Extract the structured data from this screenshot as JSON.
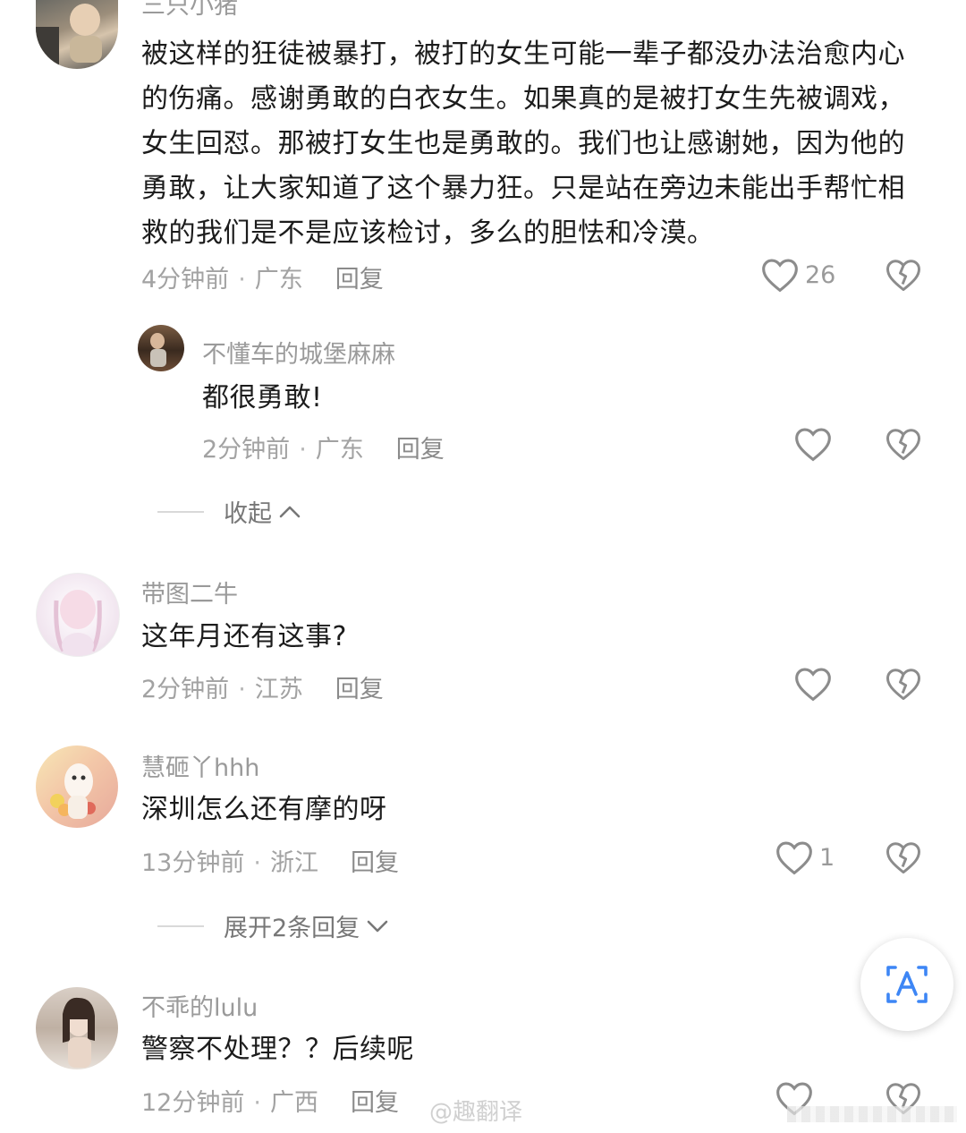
{
  "comments": [
    {
      "username": "三只小猪",
      "content": "被这样的狂徒被暴打，被打的女生可能一辈子都没办法治愈内心的伤痛。感谢勇敢的白衣女生。如果真的是被打女生先被调戏，女生回怼。那被打女生也是勇敢的。我们也让感谢她，因为他的勇敢，让大家知道了这个暴力狂。只是站在旁边未能出手帮忙相救的我们是不是应该检讨，多么的胆怯和冷漠。",
      "time": "4分钟前",
      "location": "广东",
      "reply": "回复",
      "likes": "26"
    },
    {
      "username": "不懂车的城堡麻麻",
      "content": "都很勇敢!",
      "time": "2分钟前",
      "location": "广东",
      "reply": "回复"
    },
    {
      "username": "带图二牛",
      "content": "这年月还有这事?",
      "time": "2分钟前",
      "location": "江苏",
      "reply": "回复"
    },
    {
      "username": "慧砸丫hhh",
      "content": "深圳怎么还有摩的呀",
      "time": "13分钟前",
      "location": "浙江",
      "reply": "回复",
      "likes": "1"
    },
    {
      "username": "不乖的lulu",
      "content": "警察不处理？？后续呢",
      "time": "12分钟前",
      "location": "广西",
      "reply": "回复"
    }
  ],
  "collapse_label": "收起",
  "expand_label": "展开2条回复",
  "watermark": "@趣翻译",
  "colors": {
    "text": "#1c1c1c",
    "meta": "#a2a2a2",
    "icon": "#8c8c8c",
    "translate_accent": "#3d86f5"
  },
  "icons": [
    "heart-outline-icon",
    "broken-heart-icon",
    "chevron-up-icon",
    "chevron-down-icon",
    "translate-icon"
  ]
}
